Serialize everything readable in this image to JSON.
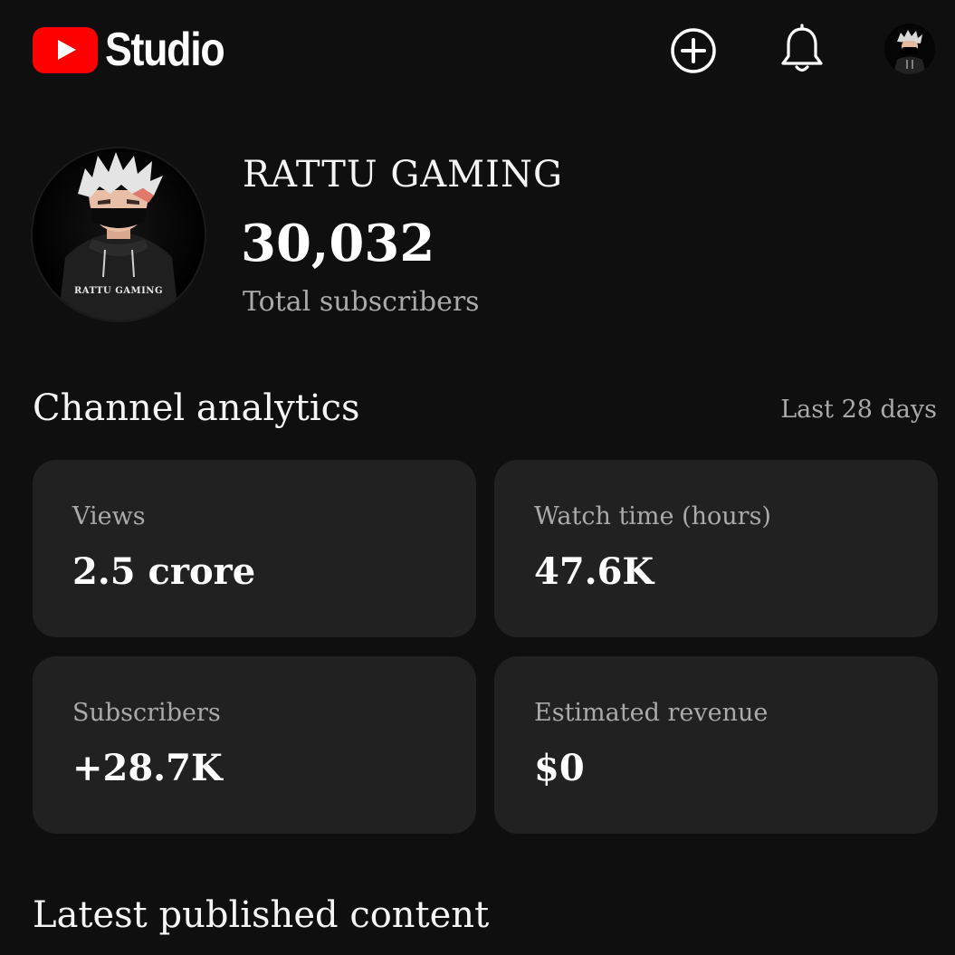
{
  "header": {
    "app_name": "Studio",
    "brand_color": "#ff0000",
    "icons": [
      "youtube-logo-icon",
      "create-icon",
      "bell-icon",
      "account-avatar"
    ]
  },
  "channel": {
    "name": "RATTU GAMING",
    "avatar_caption": "RATTU GAMING",
    "subscriber_count": "30,032",
    "subscriber_label": "Total subscribers"
  },
  "analytics": {
    "title": "Channel analytics",
    "period": "Last 28 days",
    "cards": [
      {
        "label": "Views",
        "value": "2.5 crore"
      },
      {
        "label": "Watch time (hours)",
        "value": "47.6K"
      },
      {
        "label": "Subscribers",
        "value": "+28.7K"
      },
      {
        "label": "Estimated revenue",
        "value": "$0"
      }
    ]
  },
  "latest": {
    "title": "Latest published content"
  }
}
